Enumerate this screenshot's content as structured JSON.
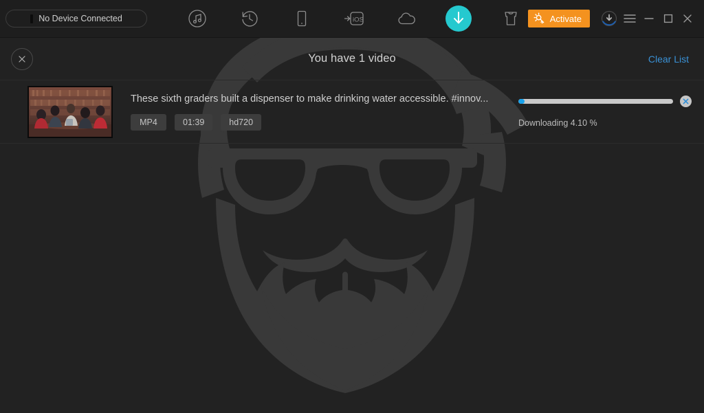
{
  "window": {
    "device_status": "No Device Connected",
    "activate_label": "Activate",
    "accent_teal": "#25c9cf",
    "accent_orange": "#f4921f",
    "accent_blue": "#18a2ec",
    "link_blue": "#3a91d6"
  },
  "toolbar": {
    "items": [
      {
        "icon": "music-disc-icon",
        "name": "music"
      },
      {
        "icon": "history-clock-icon",
        "name": "restore"
      },
      {
        "icon": "phone-icon",
        "name": "device"
      },
      {
        "icon": "to-ios-icon",
        "name": "to-ios",
        "label": "iOS"
      },
      {
        "icon": "cloud-icon",
        "name": "cloud"
      },
      {
        "icon": "download-arrow-icon",
        "name": "downloader",
        "active": true
      },
      {
        "icon": "tshirt-icon",
        "name": "ringtone-maker"
      }
    ]
  },
  "window_controls": {
    "download_status": "download-status-icon",
    "menu": "hamburger-menu-icon",
    "minimize": "minimize-icon",
    "maximize": "maximize-icon",
    "close": "close-icon"
  },
  "list_header": {
    "close_label": "close-list-icon",
    "title": "You have 1 video",
    "clear_list_label": "Clear List"
  },
  "videos": [
    {
      "title": "These sixth graders built a dispenser to make drinking water accessible. #innov...",
      "format": "MP4",
      "duration": "01:39",
      "quality": "hd720",
      "progress_percent": 4.1,
      "status": "Downloading 4.10 %"
    }
  ],
  "watermark": {
    "name": "hipster-beard-logo",
    "color": "#393939"
  }
}
